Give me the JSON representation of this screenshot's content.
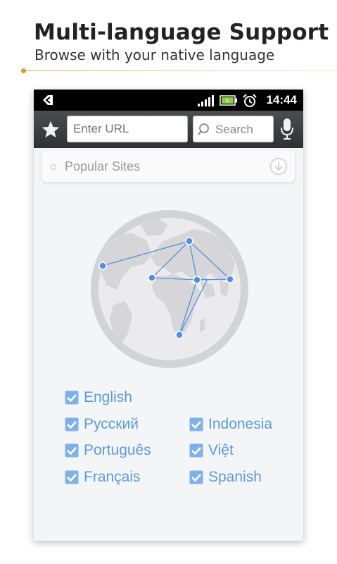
{
  "promo": {
    "title": "Multi-language Support",
    "subtitle": "Browse with your native language"
  },
  "status_bar": {
    "time": "14:44",
    "icons": [
      "back-arrow-icon",
      "signal-icon",
      "battery-icon",
      "alarm-clock-icon"
    ]
  },
  "toolbar": {
    "url_placeholder": "Enter URL",
    "search_label": "Search",
    "icons": [
      "star-icon",
      "search-icon",
      "microphone-icon"
    ]
  },
  "popular_sites": {
    "label": "Popular Sites"
  },
  "languages": {
    "left": [
      {
        "label": "English",
        "checked": true
      },
      {
        "label": "Русский",
        "checked": true
      },
      {
        "label": "Português",
        "checked": true
      },
      {
        "label": "Français",
        "checked": true
      }
    ],
    "right": [
      {
        "label": "Indonesia",
        "checked": true
      },
      {
        "label": "Việt",
        "checked": true
      },
      {
        "label": "Spanish",
        "checked": true
      }
    ]
  },
  "colors": {
    "accent_line": "#e8982a",
    "language_text": "#5b9ae0",
    "connection_line": "#4f8fe6",
    "globe": "#d2d3d5"
  }
}
